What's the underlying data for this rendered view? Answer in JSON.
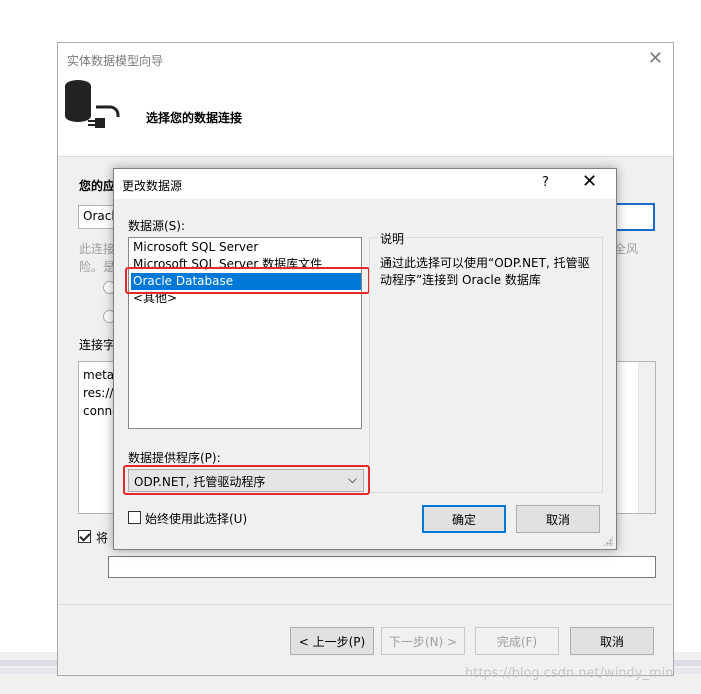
{
  "wizard": {
    "title": "实体数据模型向导",
    "heading": "选择您的数据连接",
    "section_label": "您的应",
    "conn_combo_value": "Oracle",
    "warn_line1": "此连接",
    "warn_line2": "险。是",
    "warn_right": "全风",
    "conn_string_label": "连接字",
    "conn_text": [
      "metad",
      "res://",
      "conne"
    ],
    "save_label": "将",
    "buttons": {
      "prev": "< 上一步(P)",
      "next": "下一步(N) >",
      "finish": "完成(F)",
      "cancel": "取消"
    }
  },
  "dialog": {
    "title": "更改数据源",
    "help": "?",
    "close": "✕",
    "source_label": "数据源(S):",
    "sources": [
      "Microsoft SQL Server",
      "Microsoft SQL Server 数据库文件",
      "Oracle Database",
      "<其他>"
    ],
    "selected_index": 2,
    "description_legend": "说明",
    "description_text": "通过此选择可以使用“ODP.NET, 托管驱动程序”连接到 Oracle 数据库",
    "provider_label": "数据提供程序(P):",
    "provider_value": "ODP.NET, 托管驱动程序",
    "always_use_label": "始终使用此选择(U)",
    "ok_label": "确定",
    "cancel_label": "取消"
  },
  "watermark": "https://blog.csdn.net/windy_min",
  "colors": {
    "accent": "#0078d7",
    "highlight_red": "#e8272a"
  }
}
